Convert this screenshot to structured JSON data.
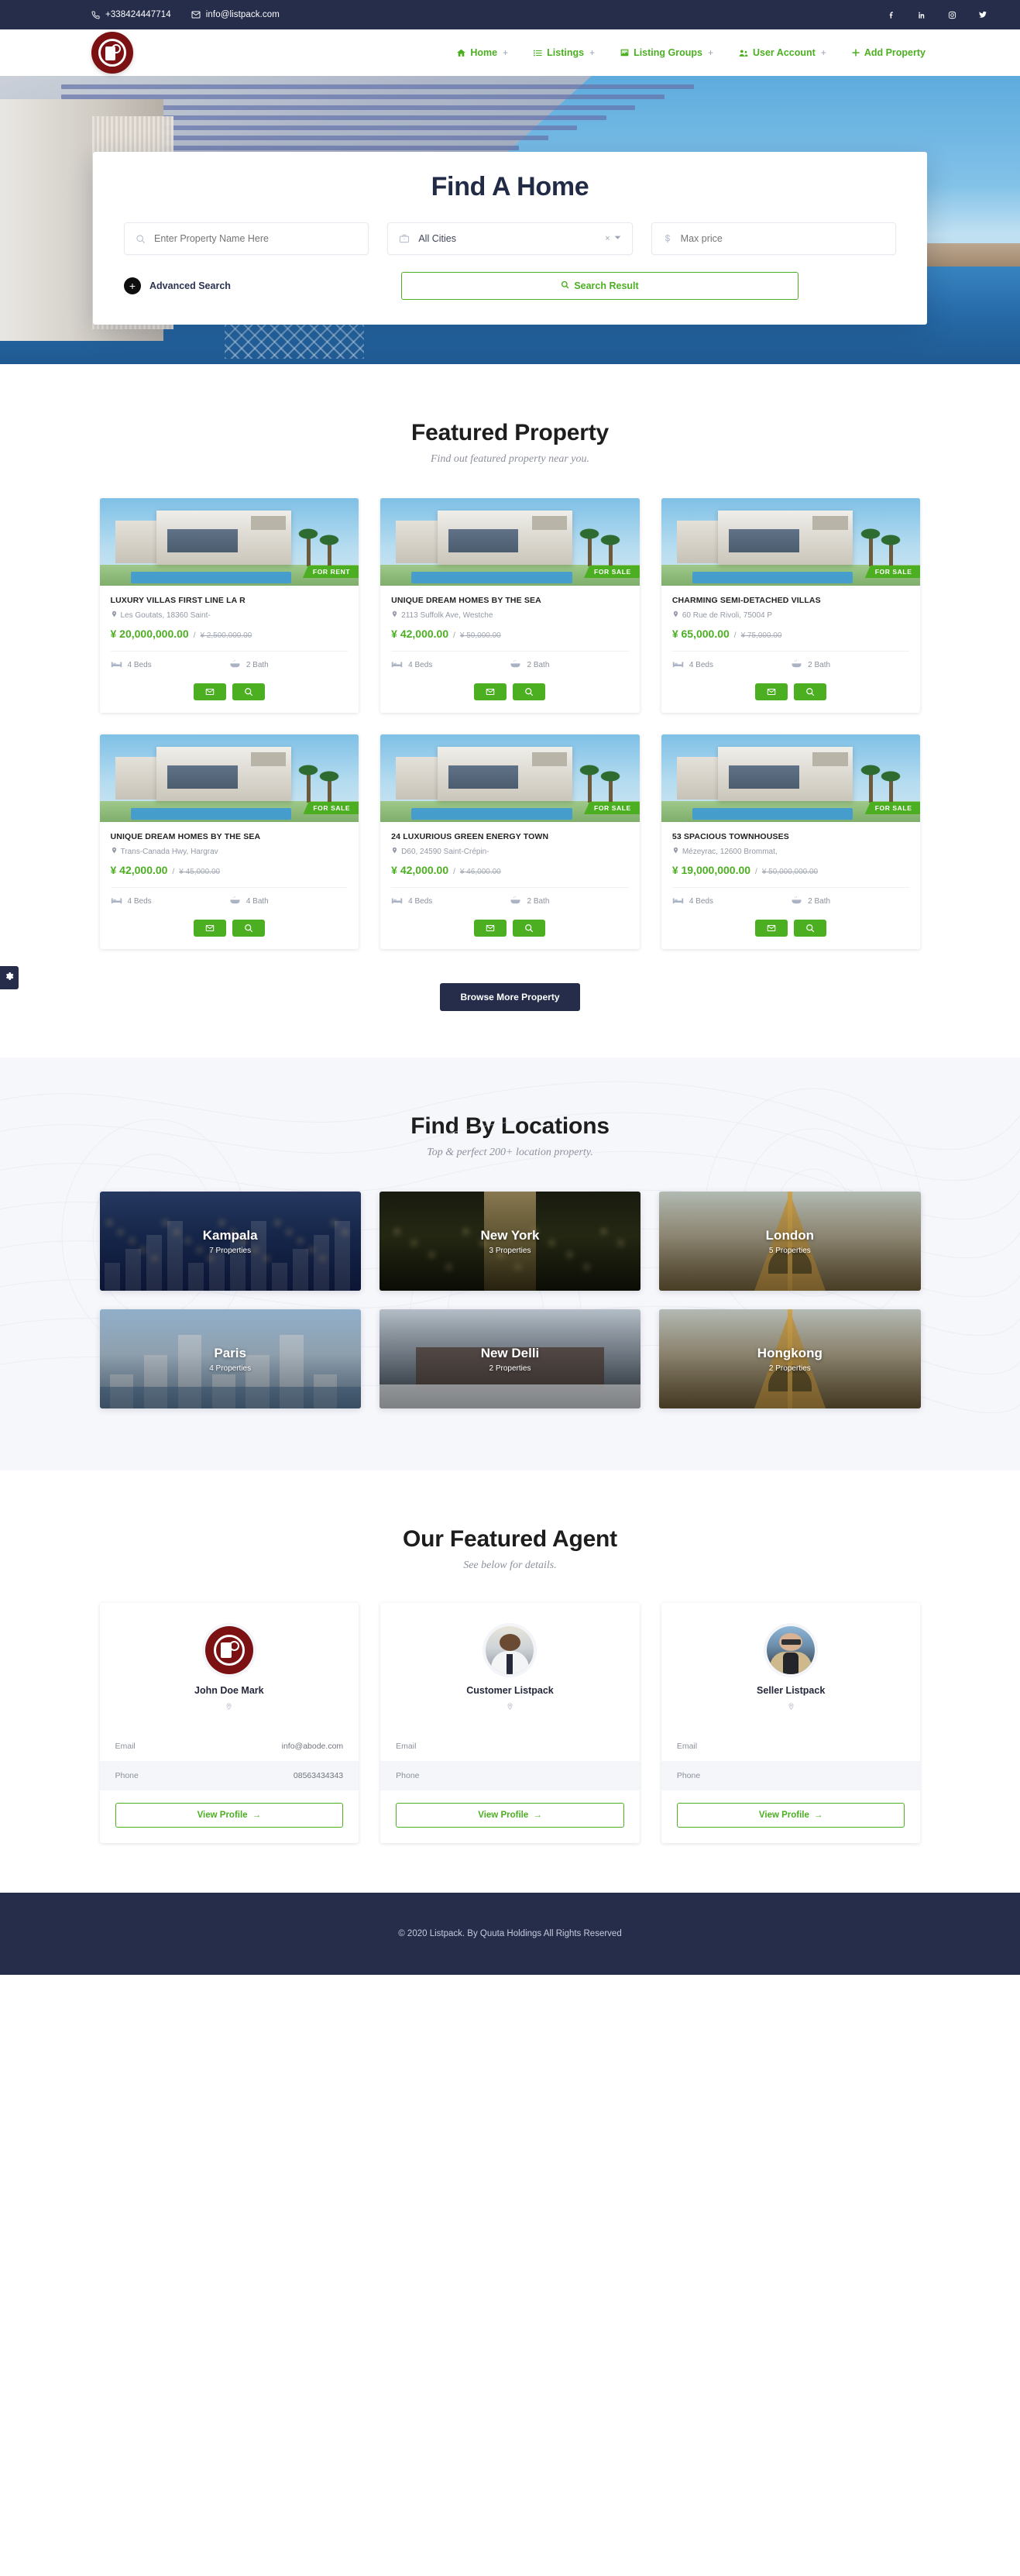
{
  "topbar": {
    "phone": "+338424447714",
    "email": "info@listpack.com",
    "phone_icon": "phone-icon",
    "email_icon": "envelope-icon",
    "socials": [
      {
        "name": "facebook-icon",
        "label": "Facebook"
      },
      {
        "name": "linkedin-icon",
        "label": "LinkedIn"
      },
      {
        "name": "instagram-icon",
        "label": "Instagram"
      },
      {
        "name": "twitter-icon",
        "label": "Twitter"
      }
    ]
  },
  "nav": {
    "logo_alt": "Listpack",
    "items": [
      {
        "label": "Home",
        "icon": "home-icon",
        "caret": "+"
      },
      {
        "label": "Listings",
        "icon": "list-icon",
        "caret": "+"
      },
      {
        "label": "Listing Groups",
        "icon": "image-icon",
        "caret": "+"
      },
      {
        "label": "User Account",
        "icon": "users-icon",
        "caret": "+"
      },
      {
        "label": "Add Property",
        "icon": "plus-icon",
        "caret": ""
      }
    ]
  },
  "hero": {
    "title": "Find A Home",
    "property_name_placeholder": "Enter Property Name Here",
    "property_name_value": "",
    "city_value": "All Cities",
    "city_clear": "×",
    "max_price_placeholder": "Max price",
    "max_price_value": "",
    "currency_symbol": "$",
    "advanced_search_label": "Advanced Search",
    "advanced_search_toggle": "+",
    "search_button_label": "Search Result"
  },
  "featured": {
    "title": "Featured Property",
    "subtitle": "Find out featured property near you.",
    "browse_label": "Browse More Property",
    "properties": [
      {
        "title": "LUXURY VILLAS FIRST LINE LA R",
        "address": "Les Goutats, 18360 Saint-",
        "price": "¥ 20,000,000.00",
        "old_price": "¥ 2,500,000.00",
        "beds": "4 Beds",
        "baths": "2 Bath",
        "badge": "FOR RENT",
        "art": "villa-1"
      },
      {
        "title": "UNIQUE DREAM HOMES BY THE SEA",
        "address": "2113 Suffolk Ave, Westche",
        "price": "¥ 42,000.00",
        "old_price": "¥ 50,000.00",
        "beds": "4 Beds",
        "baths": "2 Bath",
        "badge": "FOR SALE",
        "art": "villa-2"
      },
      {
        "title": "CHARMING SEMI-DETACHED VILLAS",
        "address": "60 Rue de Rivoli, 75004 P",
        "price": "¥ 65,000.00",
        "old_price": "¥ 75,000.00",
        "beds": "4 Beds",
        "baths": "2 Bath",
        "badge": "FOR SALE",
        "art": "villa-3"
      },
      {
        "title": "UNIQUE DREAM HOMES BY THE SEA",
        "address": "Trans-Canada Hwy, Hargrav",
        "price": "¥ 42,000.00",
        "old_price": "¥ 45,000.00",
        "beds": "4 Beds",
        "baths": "4 Bath",
        "badge": "FOR SALE",
        "art": "villa-4"
      },
      {
        "title": "24 LUXURIOUS GREEN ENERGY TOWN",
        "address": "D60, 24590 Saint-Crépin-",
        "price": "¥ 42,000.00",
        "old_price": "¥ 46,000.00",
        "beds": "4 Beds",
        "baths": "2 Bath",
        "badge": "FOR SALE",
        "art": "villa-5"
      },
      {
        "title": "53 SPACIOUS TOWNHOUSES",
        "address": "Mézeyrac, 12600 Brommat,",
        "price": "¥ 19,000,000.00",
        "old_price": "¥ 50,000,000.00",
        "beds": "4 Beds",
        "baths": "2 Bath",
        "badge": "FOR SALE",
        "art": "villa-6"
      }
    ]
  },
  "locations": {
    "title": "Find By Locations",
    "subtitle": "Top & perfect 200+ location property.",
    "cities": [
      {
        "name": "Kampala",
        "count": "7 Properties",
        "art": "city-kampala"
      },
      {
        "name": "New York",
        "count": "3 Properties",
        "art": "city-newyork"
      },
      {
        "name": "London",
        "count": "5 Properties",
        "art": "city-london"
      },
      {
        "name": "Paris",
        "count": "4 Properties",
        "art": "city-paris"
      },
      {
        "name": "New Delli",
        "count": "2 Properties",
        "art": "city-delhi"
      },
      {
        "name": "Hongkong",
        "count": "2 Properties",
        "art": "city-hongkong"
      }
    ]
  },
  "agents": {
    "title": "Our Featured Agent",
    "subtitle": "See below for details.",
    "email_label": "Email",
    "phone_label": "Phone",
    "view_profile_label": "View Profile",
    "view_profile_arrow": "→",
    "list": [
      {
        "name": "John Doe Mark",
        "email": "info@abode.com",
        "phone": "08563434343",
        "avatar": "logo-avatar"
      },
      {
        "name": "Customer Listpack",
        "email": "",
        "phone": "",
        "avatar": "photo-avatar-1"
      },
      {
        "name": "Seller Listpack",
        "email": "",
        "phone": "",
        "avatar": "photo-avatar-2"
      }
    ]
  },
  "footer": {
    "text": "© 2020 Listpack. By Quuta Holdings All Rights Reserved"
  },
  "colors": {
    "accent_green": "#4caf22",
    "dark_navy": "#252d4a",
    "brand_maroon": "#7b1113",
    "muted_text": "#8a909c"
  },
  "side_tab": {
    "icon": "gear-icon"
  }
}
